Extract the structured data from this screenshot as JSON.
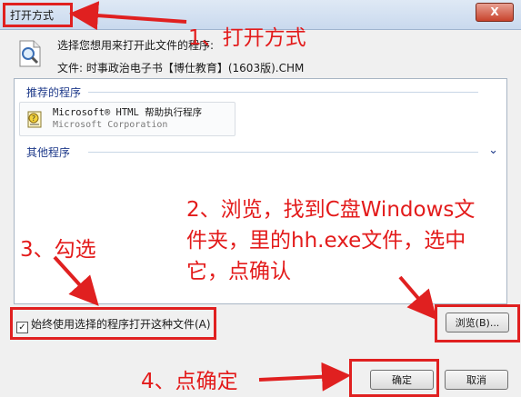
{
  "dialog": {
    "title": "打开方式",
    "close_label": "X",
    "prompt": "选择您想用来打开此文件的程序:",
    "file_line": "文件:  时事政治电子书【博仕教育】(1603版).CHM"
  },
  "programs": {
    "recommended_header": "推荐的程序",
    "items": [
      {
        "name": "Microsoft® HTML 帮助执行程序",
        "company": "Microsoft Corporation"
      }
    ],
    "other_header": "其他程序",
    "other_chevron": "⌄"
  },
  "options": {
    "always_use_label": "始终使用选择的程序打开这种文件(A)",
    "always_use_checked": true,
    "check_mark": "✓"
  },
  "buttons": {
    "browse": "浏览(B)...",
    "ok": "确定",
    "cancel": "取消"
  },
  "annotations": {
    "step1": "1、打开方式",
    "step2_line1": "2、浏览，找到C盘Windows文",
    "step2_line2": "件夹，里的hh.exe文件，选中",
    "step2_line3": "它，点确认",
    "step3": "3、勾选",
    "step4": "4、点确定"
  },
  "colors": {
    "annotation_red": "#e02020",
    "header_blue": "#1e3a8a"
  },
  "icons": {
    "document": "document-magnifier-icon",
    "program": "help-file-icon",
    "chevron": "chevron-down-icon",
    "close": "close-icon"
  }
}
